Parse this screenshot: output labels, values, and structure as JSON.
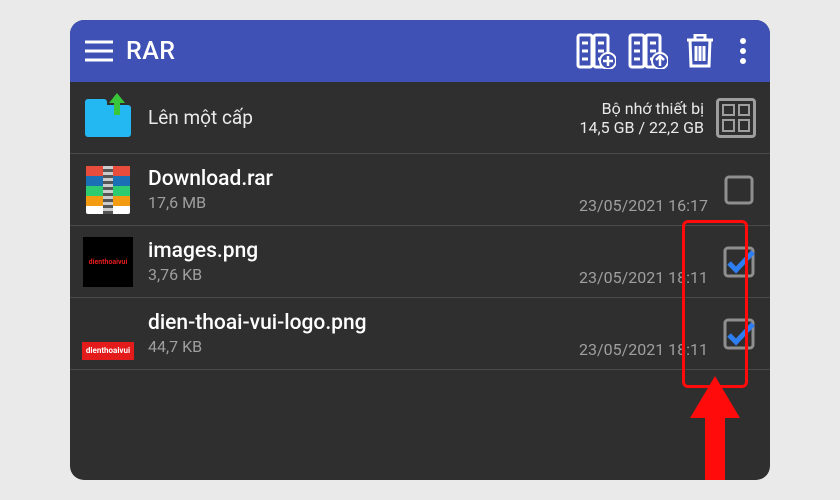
{
  "app": {
    "title": "RAR"
  },
  "header": {
    "storage_label": "Bộ nhớ thiết bị",
    "storage_value": "14,5 GB / 22,2 GB",
    "up_label": "Lên một cấp"
  },
  "files": [
    {
      "name": "Download.rar",
      "size": "17,6 MB",
      "date": "23/05/2021 16:17",
      "checked": false,
      "icon": "rar"
    },
    {
      "name": "images.png",
      "size": "3,76 KB",
      "date": "23/05/2021 18:11",
      "checked": true,
      "icon": "img1"
    },
    {
      "name": "dien-thoai-vui-logo.png",
      "size": "44,7 KB",
      "date": "23/05/2021 18:11",
      "checked": true,
      "icon": "img2"
    }
  ],
  "thumb_text": "dienthoaivui"
}
